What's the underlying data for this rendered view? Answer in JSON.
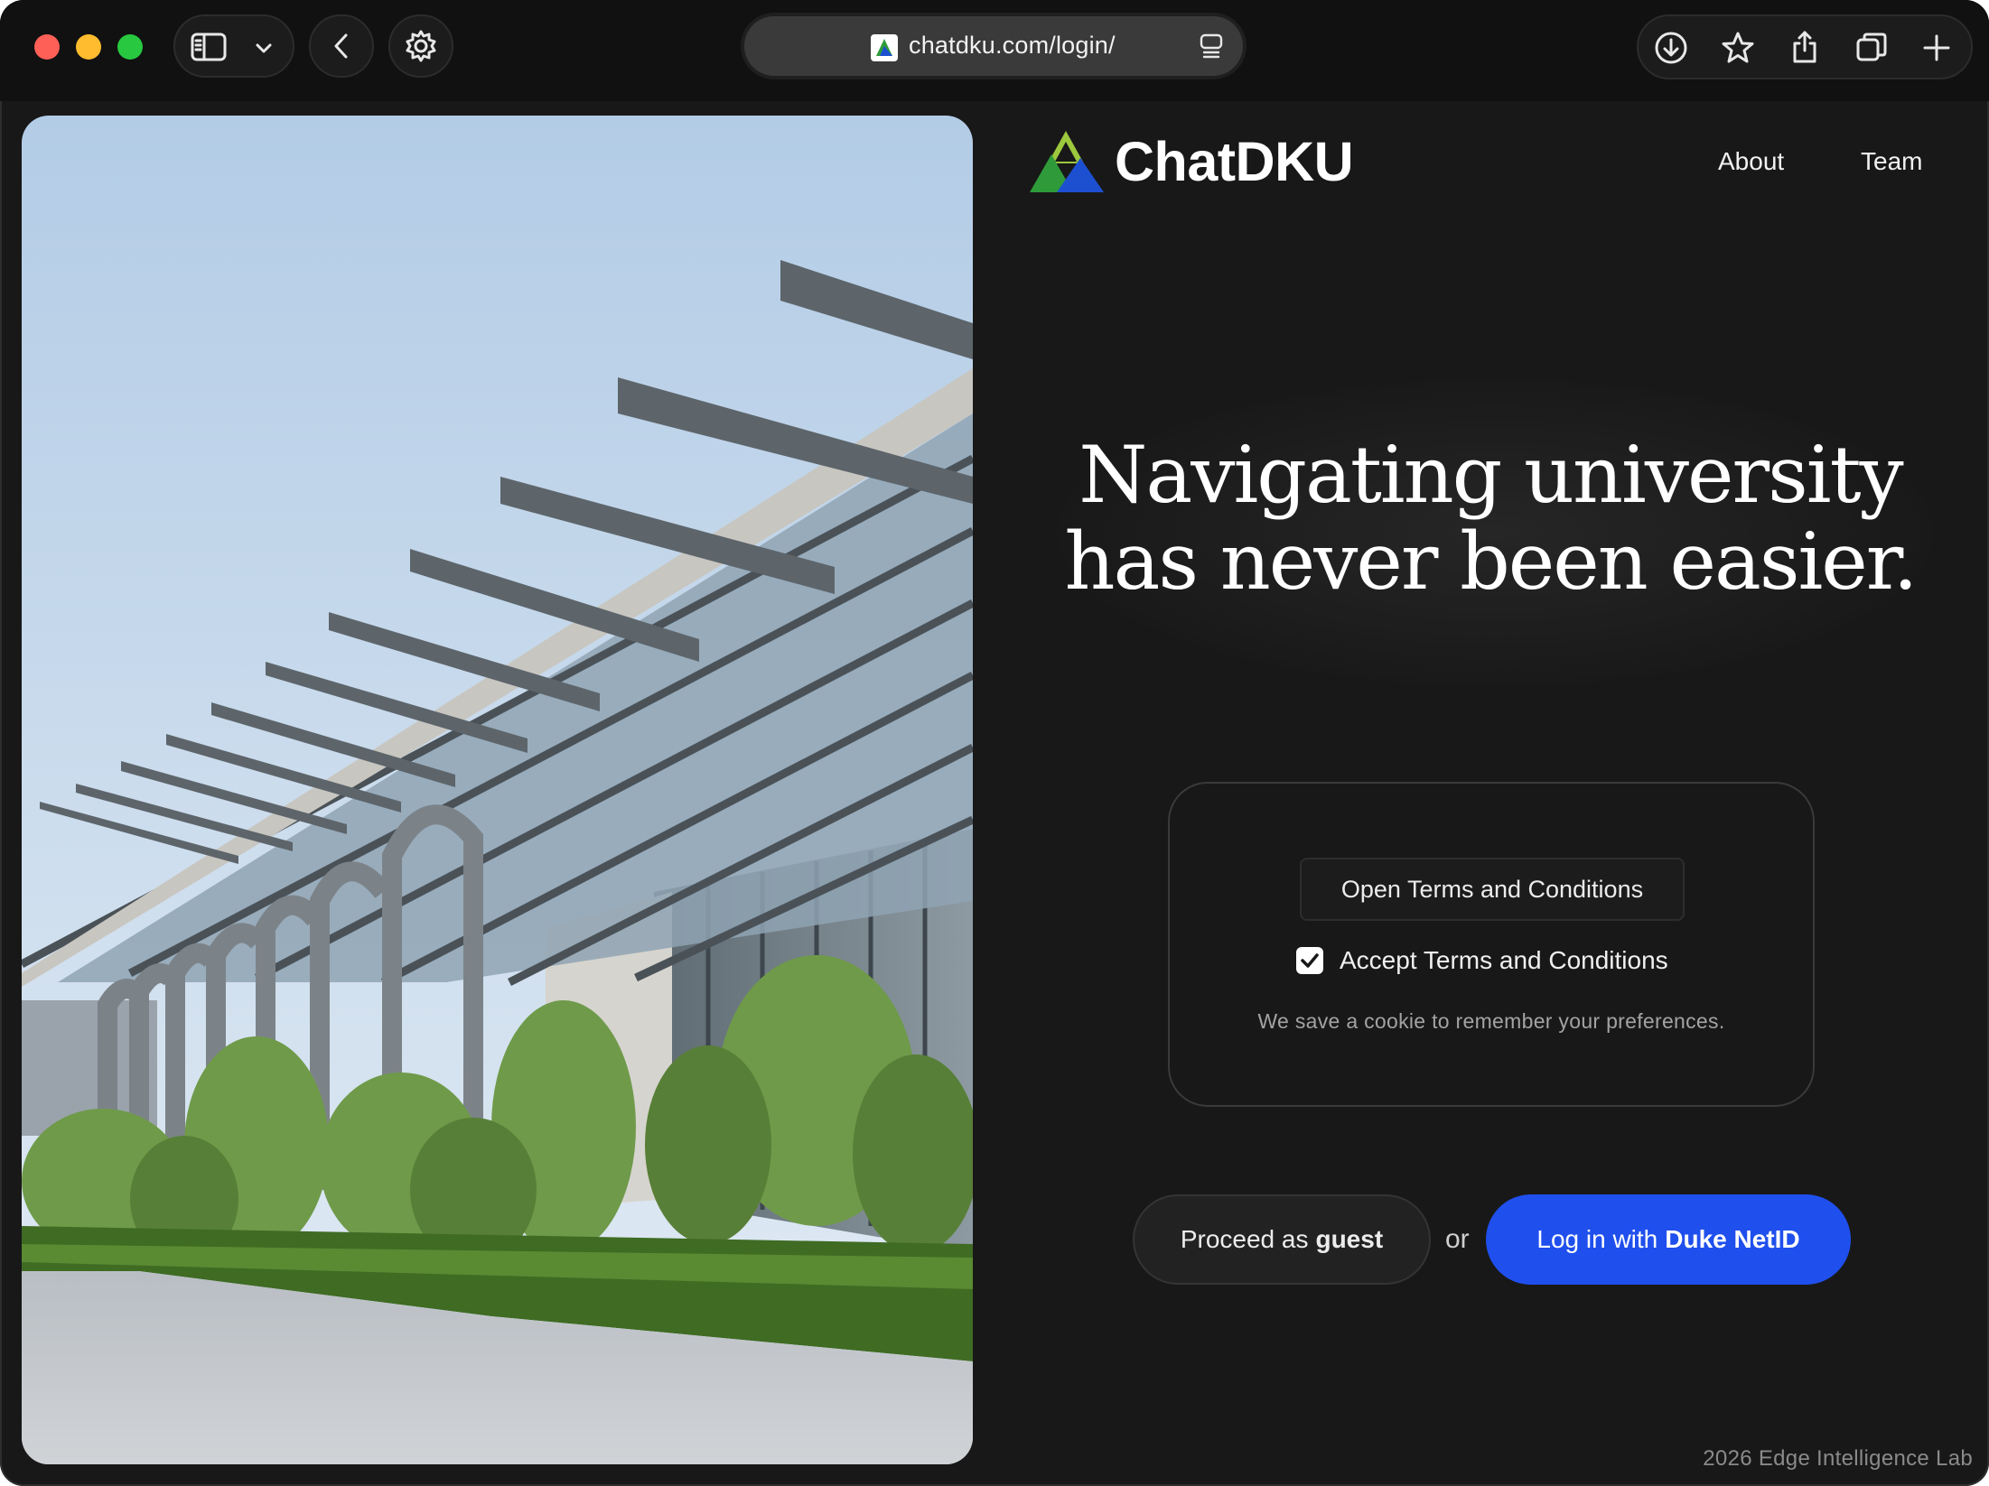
{
  "browser": {
    "url": "chatdku.com/login/",
    "icons": [
      "sidebar-icon",
      "chevron-down-icon",
      "back-icon",
      "settings-icon",
      "reader-icon",
      "download-icon",
      "star-icon",
      "share-icon",
      "tabs-icon",
      "plus-icon"
    ]
  },
  "header": {
    "brand_name": "ChatDKU",
    "nav": [
      {
        "label": "About"
      },
      {
        "label": "Team"
      }
    ]
  },
  "hero": {
    "line1": "Navigating university",
    "line2": "has never been easier."
  },
  "terms": {
    "open_label": "Open Terms and Conditions",
    "accept_label": "Accept Terms and Conditions",
    "accepted": true,
    "cookie_note": "We save a cookie to remember your preferences."
  },
  "actions": {
    "guest_prefix": "Proceed as",
    "guest_bold": "guest",
    "or_label": "or",
    "netid_prefix": "Log in with",
    "netid_bold": "Duke NetID"
  },
  "footer": {
    "text": "2026 Edge Intelligence Lab"
  },
  "colors": {
    "background": "#181818",
    "primary_button": "#1f4fed",
    "logo_green": "#2f9a3a",
    "logo_blue": "#1d4fd1",
    "logo_lime": "#9cc83d"
  }
}
